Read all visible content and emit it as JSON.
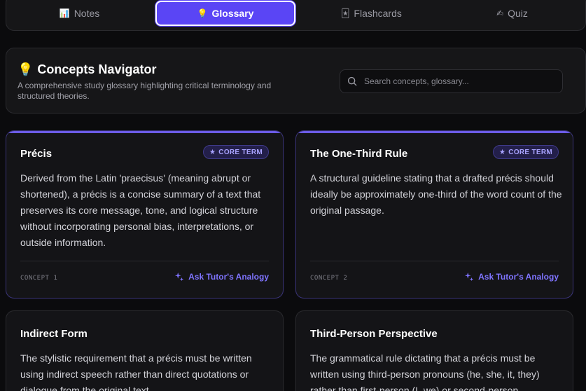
{
  "tabs": [
    {
      "icon": "📊",
      "label": "Notes",
      "active": false
    },
    {
      "icon": "💡",
      "label": "Glossary",
      "active": true
    },
    {
      "icon": "🃏",
      "label": "Flashcards",
      "active": false
    },
    {
      "icon": "✍",
      "label": "Quiz",
      "active": false
    }
  ],
  "header": {
    "icon": "💡",
    "title": "Concepts Navigator",
    "subtitle": "A comprehensive study glossary highlighting critical terminology and structured theories."
  },
  "search": {
    "placeholder": "Search concepts, glossary...",
    "value": ""
  },
  "cards": [
    {
      "name": "Précis",
      "badge": "CORE TERM",
      "description": "Derived from the Latin 'praecisus' (meaning abrupt or shortened), a précis is a concise summary of a text that preserves its core message, tone, and logical structure without incorporating personal bias, interpretations, or outside information.",
      "concept": "CONCEPT 1",
      "action": "Ask Tutor's Analogy"
    },
    {
      "name": "The One-Third Rule",
      "badge": "CORE TERM",
      "description": "A structural guideline stating that a drafted précis should ideally be approximately one-third of the word count of the original passage.",
      "concept": "CONCEPT 2",
      "action": "Ask Tutor's Analogy"
    },
    {
      "name": "Indirect Form",
      "description": "The stylistic requirement that a précis must be written using indirect speech rather than direct quotations or dialogue from the original text."
    },
    {
      "name": "Third-Person Perspective",
      "description": "The grammatical rule dictating that a précis must be written using third-person pronouns (he, she, it, they) rather than first-person (I, we) or second-person"
    }
  ],
  "colors": {
    "accent": "#5a45f5",
    "badge_text": "#a9a3ff",
    "action_text": "#7f74ff"
  }
}
